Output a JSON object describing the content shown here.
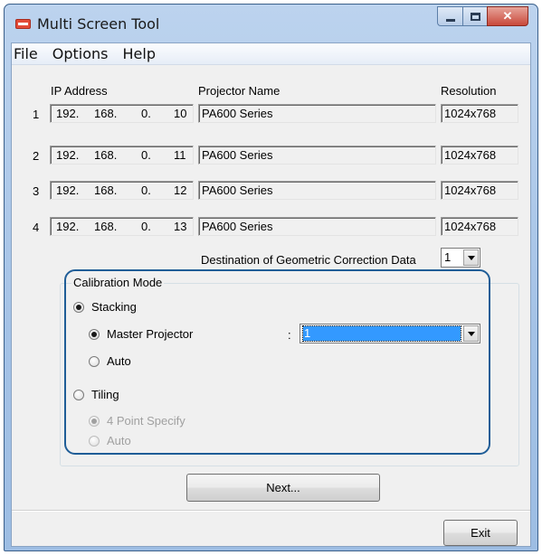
{
  "window": {
    "title": "Multi Screen Tool"
  },
  "menu": [
    "File",
    "Options",
    "Help"
  ],
  "headers": {
    "ip": "IP Address",
    "name": "Projector Name",
    "resolution": "Resolution"
  },
  "rows": [
    {
      "num": "1",
      "ip": [
        "192.",
        "168.",
        "0.",
        "10"
      ],
      "name": "PA600 Series",
      "resolution": "1024x768"
    },
    {
      "num": "2",
      "ip": [
        "192.",
        "168.",
        "0.",
        "11"
      ],
      "name": "PA600 Series",
      "resolution": "1024x768"
    },
    {
      "num": "3",
      "ip": [
        "192.",
        "168.",
        "0.",
        "12"
      ],
      "name": "PA600 Series",
      "resolution": "1024x768"
    },
    {
      "num": "4",
      "ip": [
        "192.",
        "168.",
        "0.",
        "13"
      ],
      "name": "PA600 Series",
      "resolution": "1024x768"
    }
  ],
  "destination": {
    "label": "Destination of Geometric Correction Data",
    "value": "1"
  },
  "calibration": {
    "legend": "Calibration Mode",
    "stacking": "Stacking",
    "master": "Master Projector",
    "colon": ":",
    "master_value": "1",
    "stacking_auto": "Auto",
    "tiling": "Tiling",
    "four_point": "4 Point Specify",
    "tiling_auto": "Auto"
  },
  "buttons": {
    "next": "Next...",
    "exit": "Exit"
  },
  "colors": {
    "accent_outline": "#1f5d97",
    "selection": "#3399ff"
  }
}
